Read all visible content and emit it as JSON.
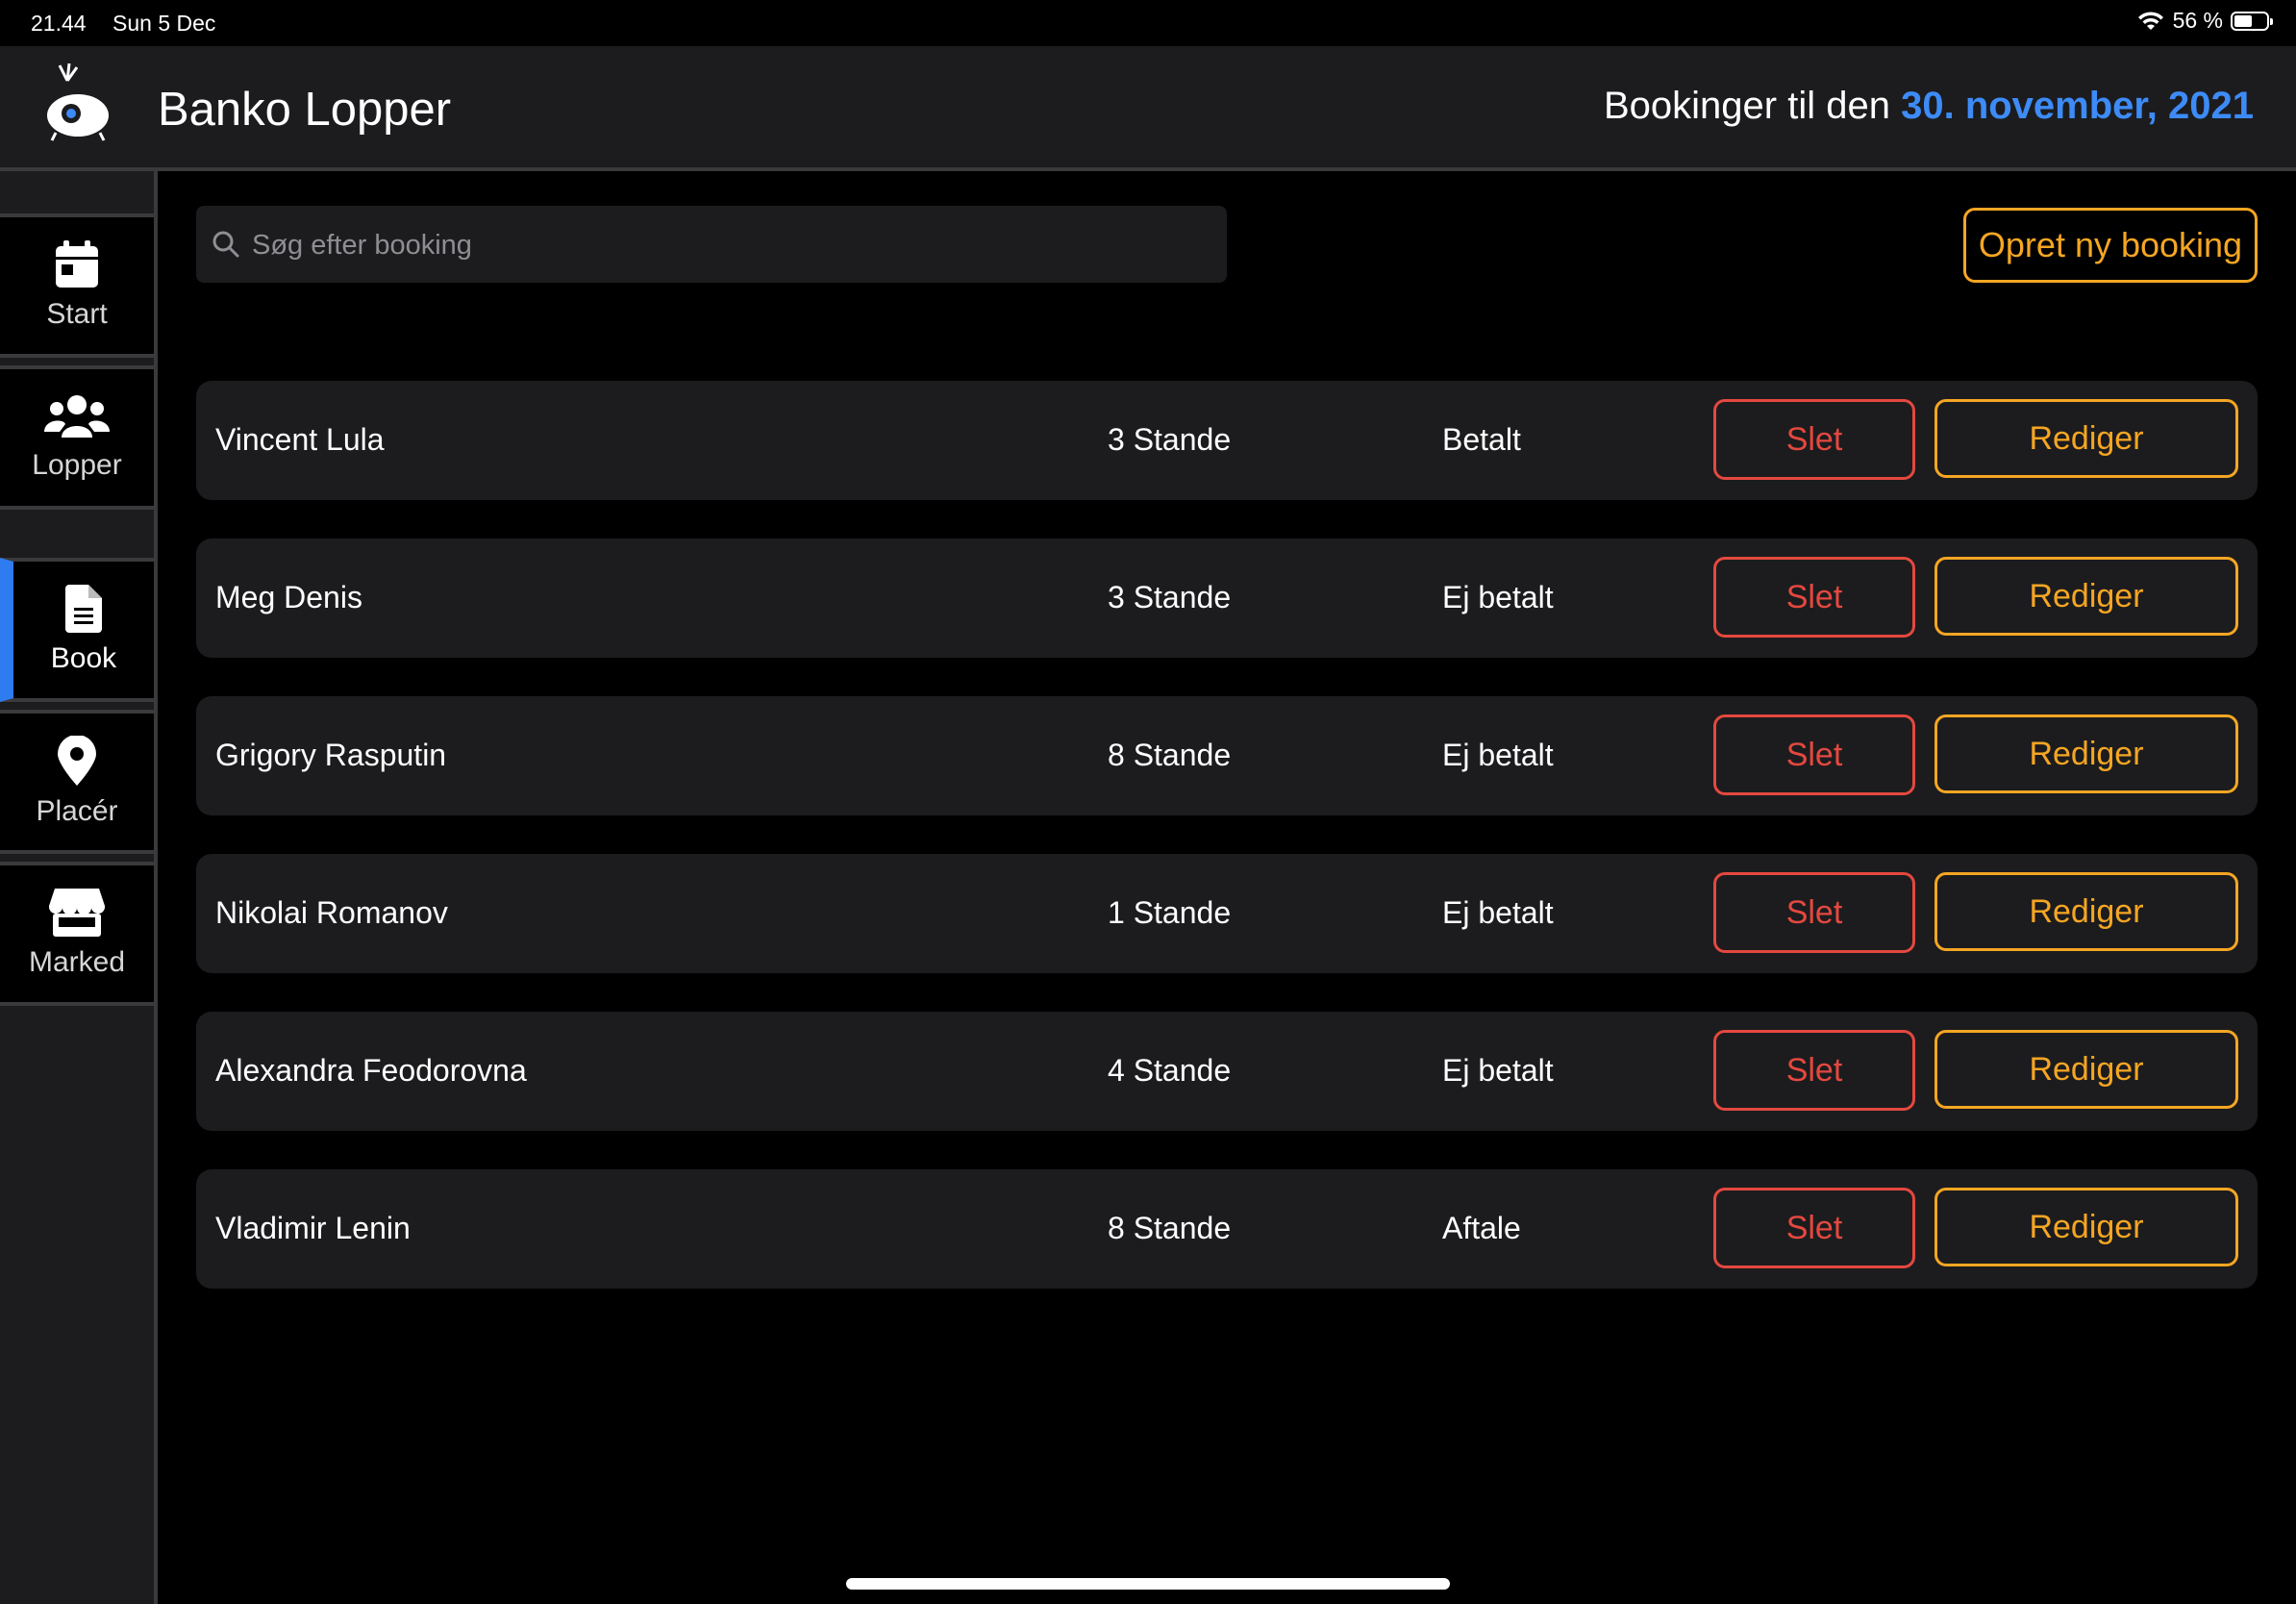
{
  "status_bar": {
    "time": "21.44",
    "date": "Sun 5 Dec",
    "battery": "56 %",
    "battery_level": 0.56
  },
  "header": {
    "app_title": "Banko Lopper",
    "booking_prefix": "Bookinger til den",
    "booking_date": "30. november, 2021",
    "date_color": "#3d8bf7"
  },
  "sidebar": {
    "active_color": "#2f7bf0",
    "items": [
      {
        "label": "Start",
        "icon": "calendar-icon"
      },
      {
        "label": "Lopper",
        "icon": "users-icon"
      },
      {
        "label": "Book",
        "icon": "document-icon"
      },
      {
        "label": "Placér",
        "icon": "map-pin-icon"
      },
      {
        "label": "Marked",
        "icon": "store-icon"
      }
    ]
  },
  "search": {
    "placeholder": "Søg efter booking",
    "value": ""
  },
  "actions": {
    "new_booking": "Opret ny booking"
  },
  "colors": {
    "accent": "#f5a623",
    "danger": "#e5483f"
  },
  "bookings": [
    {
      "name": "Vincent Lula",
      "stands": "3 Stande",
      "status": "Betalt",
      "delete": "Slet",
      "edit": "Rediger"
    },
    {
      "name": "Meg Denis",
      "stands": "3 Stande",
      "status": "Ej betalt",
      "delete": "Slet",
      "edit": "Rediger"
    },
    {
      "name": "Grigory Rasputin",
      "stands": "8 Stande",
      "status": "Ej betalt",
      "delete": "Slet",
      "edit": "Rediger"
    },
    {
      "name": "Nikolai Romanov",
      "stands": "1 Stande",
      "status": "Ej betalt",
      "delete": "Slet",
      "edit": "Rediger"
    },
    {
      "name": "Alexandra Feodorovna",
      "stands": "4 Stande",
      "status": "Ej betalt",
      "delete": "Slet",
      "edit": "Rediger"
    },
    {
      "name": "Vladimir Lenin",
      "stands": "8 Stande",
      "status": "Aftale",
      "delete": "Slet",
      "edit": "Rediger"
    }
  ]
}
